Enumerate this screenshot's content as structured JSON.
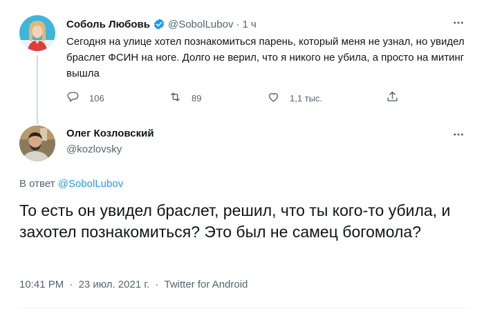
{
  "parent_tweet": {
    "author_name": "Соболь Любовь",
    "author_handle": "@SobolLubov",
    "separator": "·",
    "time_ago": "1 ч",
    "text": "Сегодня на улице хотел познакомиться парень, который меня не узнал, но увидел браслет ФСИН на ноге. Долго не верил, что я никого не убила, а просто на митинг вышла",
    "reply_count": "106",
    "retweet_count": "89",
    "like_count": "1,1 тыс."
  },
  "main_tweet": {
    "author_name": "Олег Козловский",
    "author_handle": "@kozlovsky",
    "replying_prefix": "В ответ",
    "replying_to": "@SobolLubov",
    "text": "То есть он увидел браслет, решил, что ты кого-то убила, и захотел познакомиться? Это был не самец богомола?",
    "time": "10:41 PM",
    "separator": "·",
    "date": "23 июл. 2021 г.",
    "separator2": "·",
    "source": "Twitter for Android"
  },
  "icons": {
    "verified": "verified-badge-icon",
    "more": "more-horizontal-icon",
    "reply": "reply-icon",
    "retweet": "retweet-icon",
    "like": "heart-icon",
    "share": "share-icon"
  },
  "colors": {
    "accent": "#1d9bf0",
    "muted": "#536471",
    "text": "#0f1419",
    "thread_line": "#cfd9de"
  }
}
